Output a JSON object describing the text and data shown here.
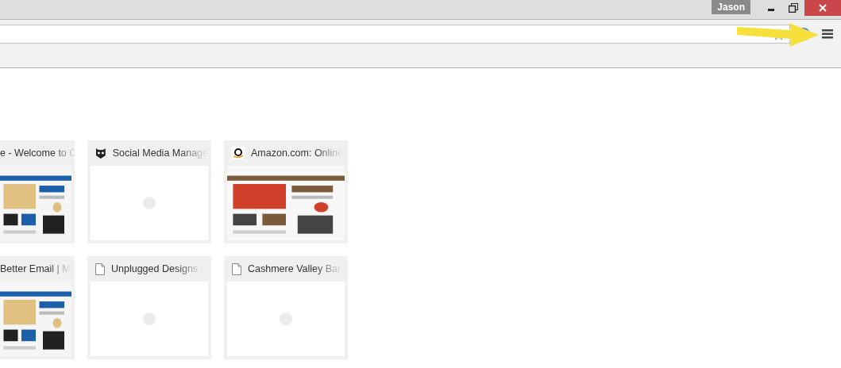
{
  "title_bar": {
    "user": "Jason"
  },
  "toolbar": {
    "bookmarked": false
  },
  "tiles": [
    {
      "title": "e - Welcome to C",
      "kind": "picture"
    },
    {
      "title": "Social Media Manage",
      "kind": "loading"
    },
    {
      "title": "Amazon.com: Online",
      "kind": "picture"
    },
    {
      "title": "Better Email | M",
      "kind": "picture"
    },
    {
      "title": "Unplugged Designs |",
      "kind": "loading"
    },
    {
      "title": "Cashmere Valley Ban",
      "kind": "loading"
    }
  ]
}
